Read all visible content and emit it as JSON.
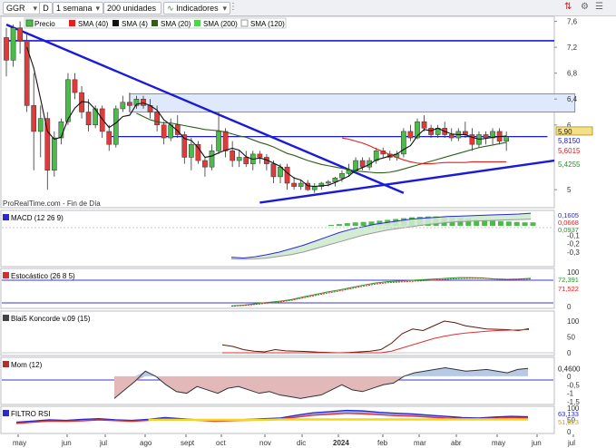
{
  "toolbar": {
    "symbol": "GGR",
    "chart_type_code": "D",
    "period": "1 semana",
    "units": "200 unidades",
    "indicators_label": "Indicadores"
  },
  "colors": {
    "up": "#4cbb4c",
    "down": "#e03b3b",
    "sma4": "#111111",
    "sma20": "#2f5e1a",
    "sma40": "#e02020",
    "trendline": "#1a1ad9",
    "zone_fill": "#dfe9fb"
  },
  "legend": {
    "precio": "Precio",
    "sma40": "SMA (40)",
    "sma4": "SMA (4)",
    "sma20": "SMA (20)",
    "sma200": "SMA (200)",
    "sma120": "SMA (120)"
  },
  "watermark": "ProRealTime.com - Fin de Día",
  "chart_data": [
    {
      "type": "candlestick",
      "title": "GGR",
      "ylim": [
        4.75,
        7.65
      ],
      "yticks": [
        "7,6",
        "7,2",
        "6,8",
        "6,4",
        "6",
        "5"
      ],
      "price_labels": [
        "5,90",
        "5,8150",
        "5,6015",
        "5,4255"
      ],
      "x_ticks": [
        "may",
        "jun",
        "jul",
        "ago",
        "sept",
        "oct",
        "nov",
        "dic",
        "2024",
        "feb",
        "mar",
        "abr",
        "may",
        "jun",
        "jul"
      ],
      "candles": [
        [
          7.35,
          7.5,
          6.75,
          7.0
        ],
        [
          7.0,
          7.55,
          6.9,
          7.5
        ],
        [
          7.5,
          7.6,
          7.1,
          7.3
        ],
        [
          7.3,
          7.4,
          6.2,
          6.3
        ],
        [
          6.3,
          6.8,
          5.3,
          5.9
        ],
        [
          5.9,
          6.3,
          5.5,
          6.1
        ],
        [
          6.1,
          6.2,
          5.0,
          5.3
        ],
        [
          5.3,
          5.9,
          5.2,
          5.8
        ],
        [
          5.8,
          6.1,
          5.7,
          6.05
        ],
        [
          6.05,
          6.8,
          6.0,
          6.7
        ],
        [
          6.7,
          6.8,
          6.4,
          6.5
        ],
        [
          6.5,
          6.6,
          6.1,
          6.2
        ],
        [
          6.2,
          6.4,
          5.9,
          6.0
        ],
        [
          6.0,
          6.3,
          5.95,
          6.25
        ],
        [
          6.25,
          6.3,
          5.8,
          5.9
        ],
        [
          5.9,
          6.0,
          5.6,
          5.7
        ],
        [
          5.7,
          6.3,
          5.65,
          6.25
        ],
        [
          6.25,
          6.45,
          6.2,
          6.35
        ],
        [
          6.35,
          6.5,
          6.2,
          6.3
        ],
        [
          6.3,
          6.45,
          6.25,
          6.4
        ],
        [
          6.4,
          6.45,
          6.25,
          6.3
        ],
        [
          6.3,
          6.4,
          6.1,
          6.2
        ],
        [
          6.2,
          6.3,
          5.9,
          6.0
        ],
        [
          6.0,
          6.05,
          5.7,
          5.8
        ],
        [
          5.8,
          6.1,
          5.75,
          6.0
        ],
        [
          6.0,
          6.15,
          5.8,
          5.85
        ],
        [
          5.85,
          5.9,
          5.4,
          5.5
        ],
        [
          5.5,
          5.8,
          5.3,
          5.7
        ],
        [
          5.7,
          5.75,
          5.4,
          5.45
        ],
        [
          5.45,
          5.5,
          5.2,
          5.35
        ],
        [
          5.35,
          5.7,
          5.3,
          5.6
        ],
        [
          5.6,
          6.2,
          5.55,
          5.9
        ],
        [
          5.9,
          5.95,
          5.5,
          5.6
        ],
        [
          5.6,
          5.75,
          5.35,
          5.45
        ],
        [
          5.45,
          5.6,
          5.35,
          5.5
        ],
        [
          5.5,
          5.6,
          5.35,
          5.4
        ],
        [
          5.4,
          5.6,
          5.3,
          5.55
        ],
        [
          5.55,
          5.6,
          5.4,
          5.5
        ],
        [
          5.5,
          5.55,
          5.3,
          5.4
        ],
        [
          5.4,
          5.45,
          5.1,
          5.2
        ],
        [
          5.2,
          5.4,
          5.1,
          5.35
        ],
        [
          5.35,
          5.4,
          5.0,
          5.1
        ],
        [
          5.1,
          5.2,
          5.0,
          5.05
        ],
        [
          5.05,
          5.15,
          5.0,
          5.1
        ],
        [
          5.1,
          5.15,
          4.98,
          5.0
        ],
        [
          5.0,
          5.1,
          4.95,
          5.05
        ],
        [
          5.05,
          5.12,
          5.0,
          5.1
        ],
        [
          5.1,
          5.15,
          5.05,
          5.12
        ],
        [
          5.12,
          5.2,
          5.05,
          5.18
        ],
        [
          5.18,
          5.3,
          5.12,
          5.25
        ],
        [
          5.25,
          5.4,
          5.2,
          5.3
        ],
        [
          5.3,
          5.5,
          5.25,
          5.45
        ],
        [
          5.45,
          5.5,
          5.3,
          5.35
        ],
        [
          5.35,
          5.5,
          5.3,
          5.45
        ],
        [
          5.45,
          5.65,
          5.4,
          5.6
        ],
        [
          5.6,
          5.65,
          5.5,
          5.55
        ],
        [
          5.55,
          5.6,
          5.45,
          5.5
        ],
        [
          5.5,
          5.6,
          5.45,
          5.55
        ],
        [
          5.55,
          5.95,
          5.5,
          5.9
        ],
        [
          5.9,
          6.0,
          5.75,
          5.8
        ],
        [
          5.8,
          6.1,
          5.78,
          6.05
        ],
        [
          6.05,
          6.15,
          5.9,
          5.95
        ],
        [
          5.95,
          6.0,
          5.8,
          5.85
        ],
        [
          5.85,
          6.0,
          5.8,
          5.95
        ],
        [
          5.95,
          6.05,
          5.8,
          5.85
        ],
        [
          5.85,
          5.95,
          5.75,
          5.8
        ],
        [
          5.8,
          5.95,
          5.75,
          5.9
        ],
        [
          5.9,
          6.05,
          5.8,
          5.85
        ],
        [
          5.85,
          5.95,
          5.6,
          5.7
        ],
        [
          5.7,
          5.9,
          5.65,
          5.85
        ],
        [
          5.85,
          5.9,
          5.7,
          5.8
        ],
        [
          5.8,
          5.95,
          5.7,
          5.9
        ],
        [
          5.9,
          5.95,
          5.7,
          5.75
        ],
        [
          5.75,
          5.9,
          5.6,
          5.82
        ]
      ],
      "series": [
        {
          "name": "SMA (4)",
          "values": [
            null,
            null,
            null,
            7.2,
            6.88,
            6.4,
            5.9,
            5.78,
            5.81,
            6.09,
            6.26,
            6.36,
            6.35,
            6.24,
            6.09,
            5.96,
            6.03,
            6.13,
            6.15,
            6.32,
            6.34,
            6.3,
            6.23,
            6.08,
            6.0,
            5.91,
            5.79,
            5.76,
            5.65,
            5.5,
            5.52,
            5.57,
            5.61,
            5.64,
            5.61,
            5.51,
            5.47,
            5.49,
            5.46,
            5.41,
            5.36,
            5.26,
            5.18,
            5.15,
            5.06,
            5.05,
            5.06,
            5.07,
            5.11,
            5.16,
            5.21,
            5.3,
            5.34,
            5.39,
            5.46,
            5.49,
            5.52,
            5.55,
            5.62,
            5.68,
            5.83,
            5.93,
            5.91,
            5.95,
            5.9,
            5.86,
            5.85,
            5.85,
            5.81,
            5.78,
            5.79,
            5.81,
            5.82,
            5.83
          ]
        },
        {
          "name": "SMA (20)",
          "values": [
            null,
            null,
            null,
            null,
            null,
            null,
            null,
            null,
            null,
            null,
            null,
            null,
            null,
            null,
            null,
            null,
            null,
            null,
            null,
            6.18,
            6.13,
            6.08,
            6.05,
            6.03,
            6.03,
            6.01,
            5.99,
            5.97,
            5.95,
            5.93,
            5.92,
            5.91,
            5.89,
            5.86,
            5.83,
            5.81,
            5.77,
            5.73,
            5.7,
            5.66,
            5.61,
            5.56,
            5.53,
            5.49,
            5.45,
            5.42,
            5.39,
            5.37,
            5.35,
            5.33,
            5.31,
            5.29,
            5.28,
            5.27,
            5.26,
            5.26,
            5.27,
            5.29,
            5.32,
            5.35,
            5.38,
            5.41,
            5.44,
            5.47,
            5.5,
            5.53,
            5.56,
            5.59,
            5.62,
            5.65,
            5.67,
            5.69,
            5.71,
            5.73
          ]
        },
        {
          "name": "SMA (40)",
          "values": [
            null,
            null,
            null,
            null,
            null,
            null,
            null,
            null,
            null,
            null,
            null,
            null,
            null,
            null,
            null,
            null,
            null,
            null,
            null,
            null,
            null,
            null,
            null,
            null,
            null,
            null,
            null,
            null,
            null,
            null,
            null,
            null,
            null,
            null,
            null,
            null,
            null,
            null,
            null,
            null,
            null,
            null,
            null,
            null,
            null,
            null,
            null,
            null,
            null,
            5.8,
            5.78,
            5.75,
            5.72,
            5.68,
            5.63,
            5.59,
            5.54,
            5.5,
            5.46,
            5.43,
            5.41,
            5.4,
            5.4,
            5.41,
            5.42,
            5.42,
            5.42,
            5.42,
            5.43,
            5.43,
            5.43,
            5.43,
            5.43,
            5.43
          ]
        }
      ],
      "annotations": {
        "trend_down": {
          "from": [
            0,
            7.55
          ],
          "to": [
            58,
            4.95
          ]
        },
        "trend_up": {
          "from": [
            37,
            4.8
          ],
          "to": [
            80,
            5.45
          ]
        },
        "resistance": {
          "value": 7.3,
          "from": 0,
          "to": 80
        },
        "support": {
          "value": 5.82,
          "from": 15,
          "to": 79
        },
        "zone": {
          "low": 6.2,
          "high": 6.48,
          "from": 18,
          "to": 83
        }
      }
    },
    {
      "type": "line",
      "title": "MACD (12 26 9)",
      "ylim": [
        -0.45,
        0.15
      ],
      "yticks": [
        "-0,1",
        "-0,2",
        "-0,3"
      ],
      "value_labels": [
        "0,1605",
        "0,0668",
        "0,0937"
      ],
      "series": [
        {
          "name": "MACD",
          "values": [
            -0.36,
            -0.37,
            -0.355,
            -0.33,
            -0.3,
            -0.26,
            -0.22,
            -0.17,
            -0.12,
            -0.07,
            -0.03,
            0.0,
            0.03,
            0.05,
            0.07,
            0.09,
            0.1,
            0.11,
            0.12,
            0.125,
            0.13,
            0.135,
            0.14,
            0.145,
            0.15,
            0.16
          ]
        },
        {
          "name": "Signal",
          "values": [
            -0.38,
            -0.385,
            -0.38,
            -0.37,
            -0.35,
            -0.33,
            -0.3,
            -0.26,
            -0.22,
            -0.18,
            -0.14,
            -0.1,
            -0.07,
            -0.04,
            -0.02,
            0.0,
            0.02,
            0.035,
            0.05,
            0.06,
            0.065,
            0.07,
            0.075,
            0.08,
            0.085,
            0.09
          ]
        }
      ],
      "histogram": [
        0.0,
        0.01,
        0.02,
        0.03,
        0.035,
        0.04,
        0.05,
        0.06,
        0.07,
        0.08,
        0.09,
        0.095,
        0.1,
        0.1,
        0.095,
        0.09,
        0.085,
        0.075,
        0.065,
        0.06,
        0.05,
        0.045,
        0.04,
        0.035,
        0.03,
        0.03
      ]
    },
    {
      "type": "line",
      "title": "Estocástico (26 8 5)",
      "ylim": [
        0,
        100
      ],
      "yticks": [
        "100",
        "0"
      ],
      "value_labels": [
        "72,391",
        "71,522"
      ],
      "series": [
        {
          "name": "%K",
          "values": [
            2,
            4,
            8,
            12,
            15,
            20,
            28,
            35,
            42,
            48,
            55,
            62,
            68,
            72,
            74,
            76,
            78,
            80,
            82,
            84,
            84,
            83,
            80,
            79,
            80,
            82
          ]
        },
        {
          "name": "%D",
          "values": [
            1,
            3,
            6,
            10,
            13,
            18,
            25,
            32,
            39,
            45,
            52,
            59,
            65,
            69,
            71,
            73,
            75,
            77,
            79,
            81,
            82,
            82,
            80,
            79,
            79,
            80
          ]
        }
      ]
    },
    {
      "type": "line",
      "title": "Blai5 Koncorde v.09 (15)",
      "ylim": [
        -10,
        120
      ],
      "yticks": [
        "100",
        "50",
        "0"
      ],
      "series": [
        {
          "name": "Marrón",
          "values": [
            25,
            20,
            10,
            5,
            3,
            10,
            6,
            5,
            4,
            2,
            1,
            0,
            1,
            3,
            5,
            10,
            30,
            60,
            75,
            70,
            85,
            100,
            95,
            85,
            80,
            75,
            74,
            73,
            70,
            76
          ]
        },
        {
          "name": "Verde",
          "values": [
            0,
            0,
            0,
            0,
            0,
            0,
            0,
            0,
            0,
            0,
            0,
            0,
            0,
            0,
            0,
            0,
            5,
            15,
            25,
            35,
            45,
            52,
            58,
            62,
            65,
            68,
            70,
            71,
            72,
            73
          ]
        }
      ]
    },
    {
      "type": "area",
      "title": "Mom (12)",
      "ylim": [
        -1.55,
        0.9
      ],
      "yticks": [
        "0,5",
        "0",
        "-0,5",
        "-1",
        "-1,5"
      ],
      "value_labels": [
        "0,4600"
      ],
      "values": [
        -1.3,
        -0.8,
        -0.3,
        0.3,
        0.0,
        -0.5,
        -0.9,
        -1.0,
        -0.6,
        -0.8,
        -1.0,
        -0.7,
        -0.6,
        -0.8,
        -1.0,
        -0.9,
        -1.1,
        -1.2,
        -1.3,
        -1.2,
        -1.1,
        -0.8,
        -0.5,
        -0.8,
        -0.9,
        -0.7,
        -0.5,
        -0.4,
        0.0,
        0.2,
        0.3,
        0.4,
        0.5,
        0.4,
        0.3,
        0.35,
        0.4,
        0.3,
        0.2,
        0.4,
        0.46
      ]
    },
    {
      "type": "line",
      "title": "FILTRO RSI",
      "ylim": [
        0,
        100
      ],
      "yticks": [
        "100",
        "50",
        "0"
      ],
      "value_labels": [
        "63,133",
        "51,823"
      ],
      "series": [
        {
          "name": "Azul",
          "values": [
            40,
            45,
            50,
            48,
            52,
            55,
            50,
            48,
            52,
            60,
            55,
            50,
            45,
            48,
            52,
            55,
            58,
            70,
            80,
            85,
            90,
            88,
            82,
            78,
            75,
            70,
            65,
            60,
            58,
            62,
            65,
            63
          ]
        },
        {
          "name": "Rojo",
          "values": [
            35,
            40,
            45,
            44,
            46,
            50,
            47,
            44,
            48,
            55,
            52,
            48,
            44,
            46,
            48,
            50,
            54,
            62,
            70,
            74,
            78,
            76,
            72,
            68,
            66,
            62,
            58,
            56,
            55,
            57,
            60,
            58
          ]
        },
        {
          "name": "Amarilla",
          "values": [
            null,
            null,
            null,
            null,
            null,
            null,
            null,
            null,
            50,
            50,
            50,
            50,
            50,
            50,
            50,
            50,
            52,
            52,
            52,
            52,
            52,
            52,
            52,
            52,
            52,
            52,
            52,
            52,
            52,
            52,
            52,
            52
          ]
        }
      ]
    }
  ]
}
